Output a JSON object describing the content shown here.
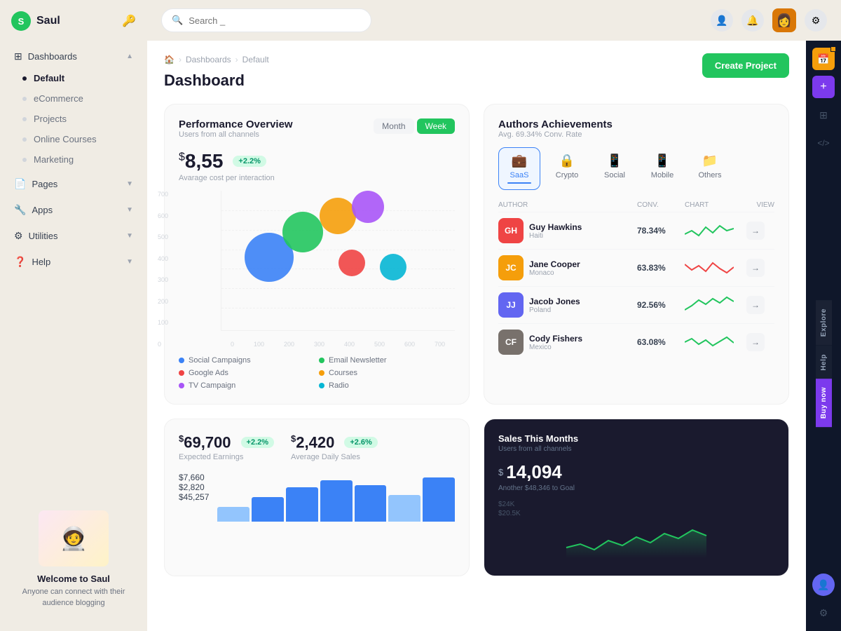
{
  "app": {
    "name": "Saul",
    "logo_letter": "S"
  },
  "topbar": {
    "search_placeholder": "Search _"
  },
  "sidebar": {
    "nav": [
      {
        "id": "dashboards",
        "label": "Dashboards",
        "icon": "⊞",
        "expandable": true,
        "expanded": true
      },
      {
        "id": "pages",
        "label": "Pages",
        "icon": "📄",
        "expandable": true
      },
      {
        "id": "apps",
        "label": "Apps",
        "icon": "🔧",
        "expandable": true
      },
      {
        "id": "utilities",
        "label": "Utilities",
        "icon": "⚙",
        "expandable": true
      },
      {
        "id": "help",
        "label": "Help",
        "icon": "❓",
        "expandable": true
      }
    ],
    "sub_items": [
      "Default",
      "eCommerce",
      "Projects",
      "Online Courses",
      "Marketing"
    ],
    "active_item": "Default",
    "welcome": {
      "title": "Welcome to Saul",
      "subtitle": "Anyone can connect with their audience blogging"
    }
  },
  "breadcrumb": {
    "home": "🏠",
    "items": [
      "Dashboards",
      "Default"
    ]
  },
  "page_title": "Dashboard",
  "create_button": "Create Project",
  "performance": {
    "title": "Performance Overview",
    "subtitle": "Users from all channels",
    "period_month": "Month",
    "period_week": "Week",
    "value": "8,55",
    "badge": "+2.2%",
    "cost_label": "Avarage cost per interaction",
    "y_labels": [
      "700",
      "600",
      "500",
      "400",
      "300",
      "200",
      "100",
      "0"
    ],
    "x_labels": [
      "0",
      "100",
      "200",
      "300",
      "400",
      "500",
      "600",
      "700"
    ],
    "bubbles": [
      {
        "color": "#3b82f6",
        "size": 70,
        "x": 18,
        "y": 42,
        "label": "Social Campaigns"
      },
      {
        "color": "#22c55e",
        "size": 58,
        "x": 33,
        "y": 32,
        "label": "Email Newsletter"
      },
      {
        "color": "#f59e0b",
        "size": 52,
        "x": 47,
        "y": 22,
        "label": "Courses"
      },
      {
        "color": "#a855f7",
        "size": 46,
        "x": 61,
        "y": 18,
        "label": "TV Campaign"
      },
      {
        "color": "#ef4444",
        "size": 38,
        "x": 55,
        "y": 52,
        "label": "Google Ads"
      },
      {
        "color": "#06b6d4",
        "size": 38,
        "x": 72,
        "y": 55,
        "label": "Radio"
      }
    ],
    "legend": [
      {
        "color": "#3b82f6",
        "label": "Social Campaigns"
      },
      {
        "color": "#ef4444",
        "label": "Google Ads"
      },
      {
        "color": "#a855f7",
        "label": "TV Campaign"
      },
      {
        "color": "#f59e0b",
        "label": "Courses"
      },
      {
        "color": "#22c55e",
        "label": "Email Newsletter"
      },
      {
        "color": "#06b6d4",
        "label": "Radio"
      }
    ]
  },
  "authors": {
    "title": "Authors Achievements",
    "subtitle": "Avg. 69.34% Conv. Rate",
    "tabs": [
      "SaaS",
      "Crypto",
      "Social",
      "Mobile",
      "Others"
    ],
    "active_tab": "SaaS",
    "tab_icons": [
      "💼",
      "🔒",
      "📱",
      "📱",
      "📁"
    ],
    "table_headers": [
      "AUTHOR",
      "CONV.",
      "CHART",
      "VIEW"
    ],
    "authors": [
      {
        "name": "Guy Hawkins",
        "country": "Haiti",
        "conv": "78.34%",
        "color": "#ef4444",
        "sparkline_color": "#22c55e"
      },
      {
        "name": "Jane Cooper",
        "country": "Monaco",
        "conv": "63.83%",
        "color": "#f59e0b",
        "sparkline_color": "#ef4444"
      },
      {
        "name": "Jacob Jones",
        "country": "Poland",
        "conv": "92.56%",
        "color": "#6366f1",
        "sparkline_color": "#22c55e"
      },
      {
        "name": "Cody Fishers",
        "country": "Mexico",
        "conv": "63.08%",
        "color": "#78716c",
        "sparkline_color": "#22c55e"
      }
    ]
  },
  "earnings": {
    "value": "69,700",
    "badge": "+2.2%",
    "label": "Expected Earnings",
    "items": [
      "$7,660",
      "$2,820",
      "$45,257"
    ]
  },
  "daily_sales": {
    "value": "2,420",
    "badge": "+2.6%",
    "label": "Average Daily Sales"
  },
  "sales_months": {
    "title": "Sales This Months",
    "subtitle": "Users from all channels",
    "value": "14,094",
    "goal": "Another $48,346 to Goal",
    "levels": [
      "$24K",
      "$20.5K"
    ]
  },
  "right_panel_actions": [
    "Explore",
    "Help",
    "Buy now"
  ],
  "far_right_icons": [
    "📅",
    "➕",
    "⊞",
    "</>",
    "👤",
    "⚙"
  ]
}
